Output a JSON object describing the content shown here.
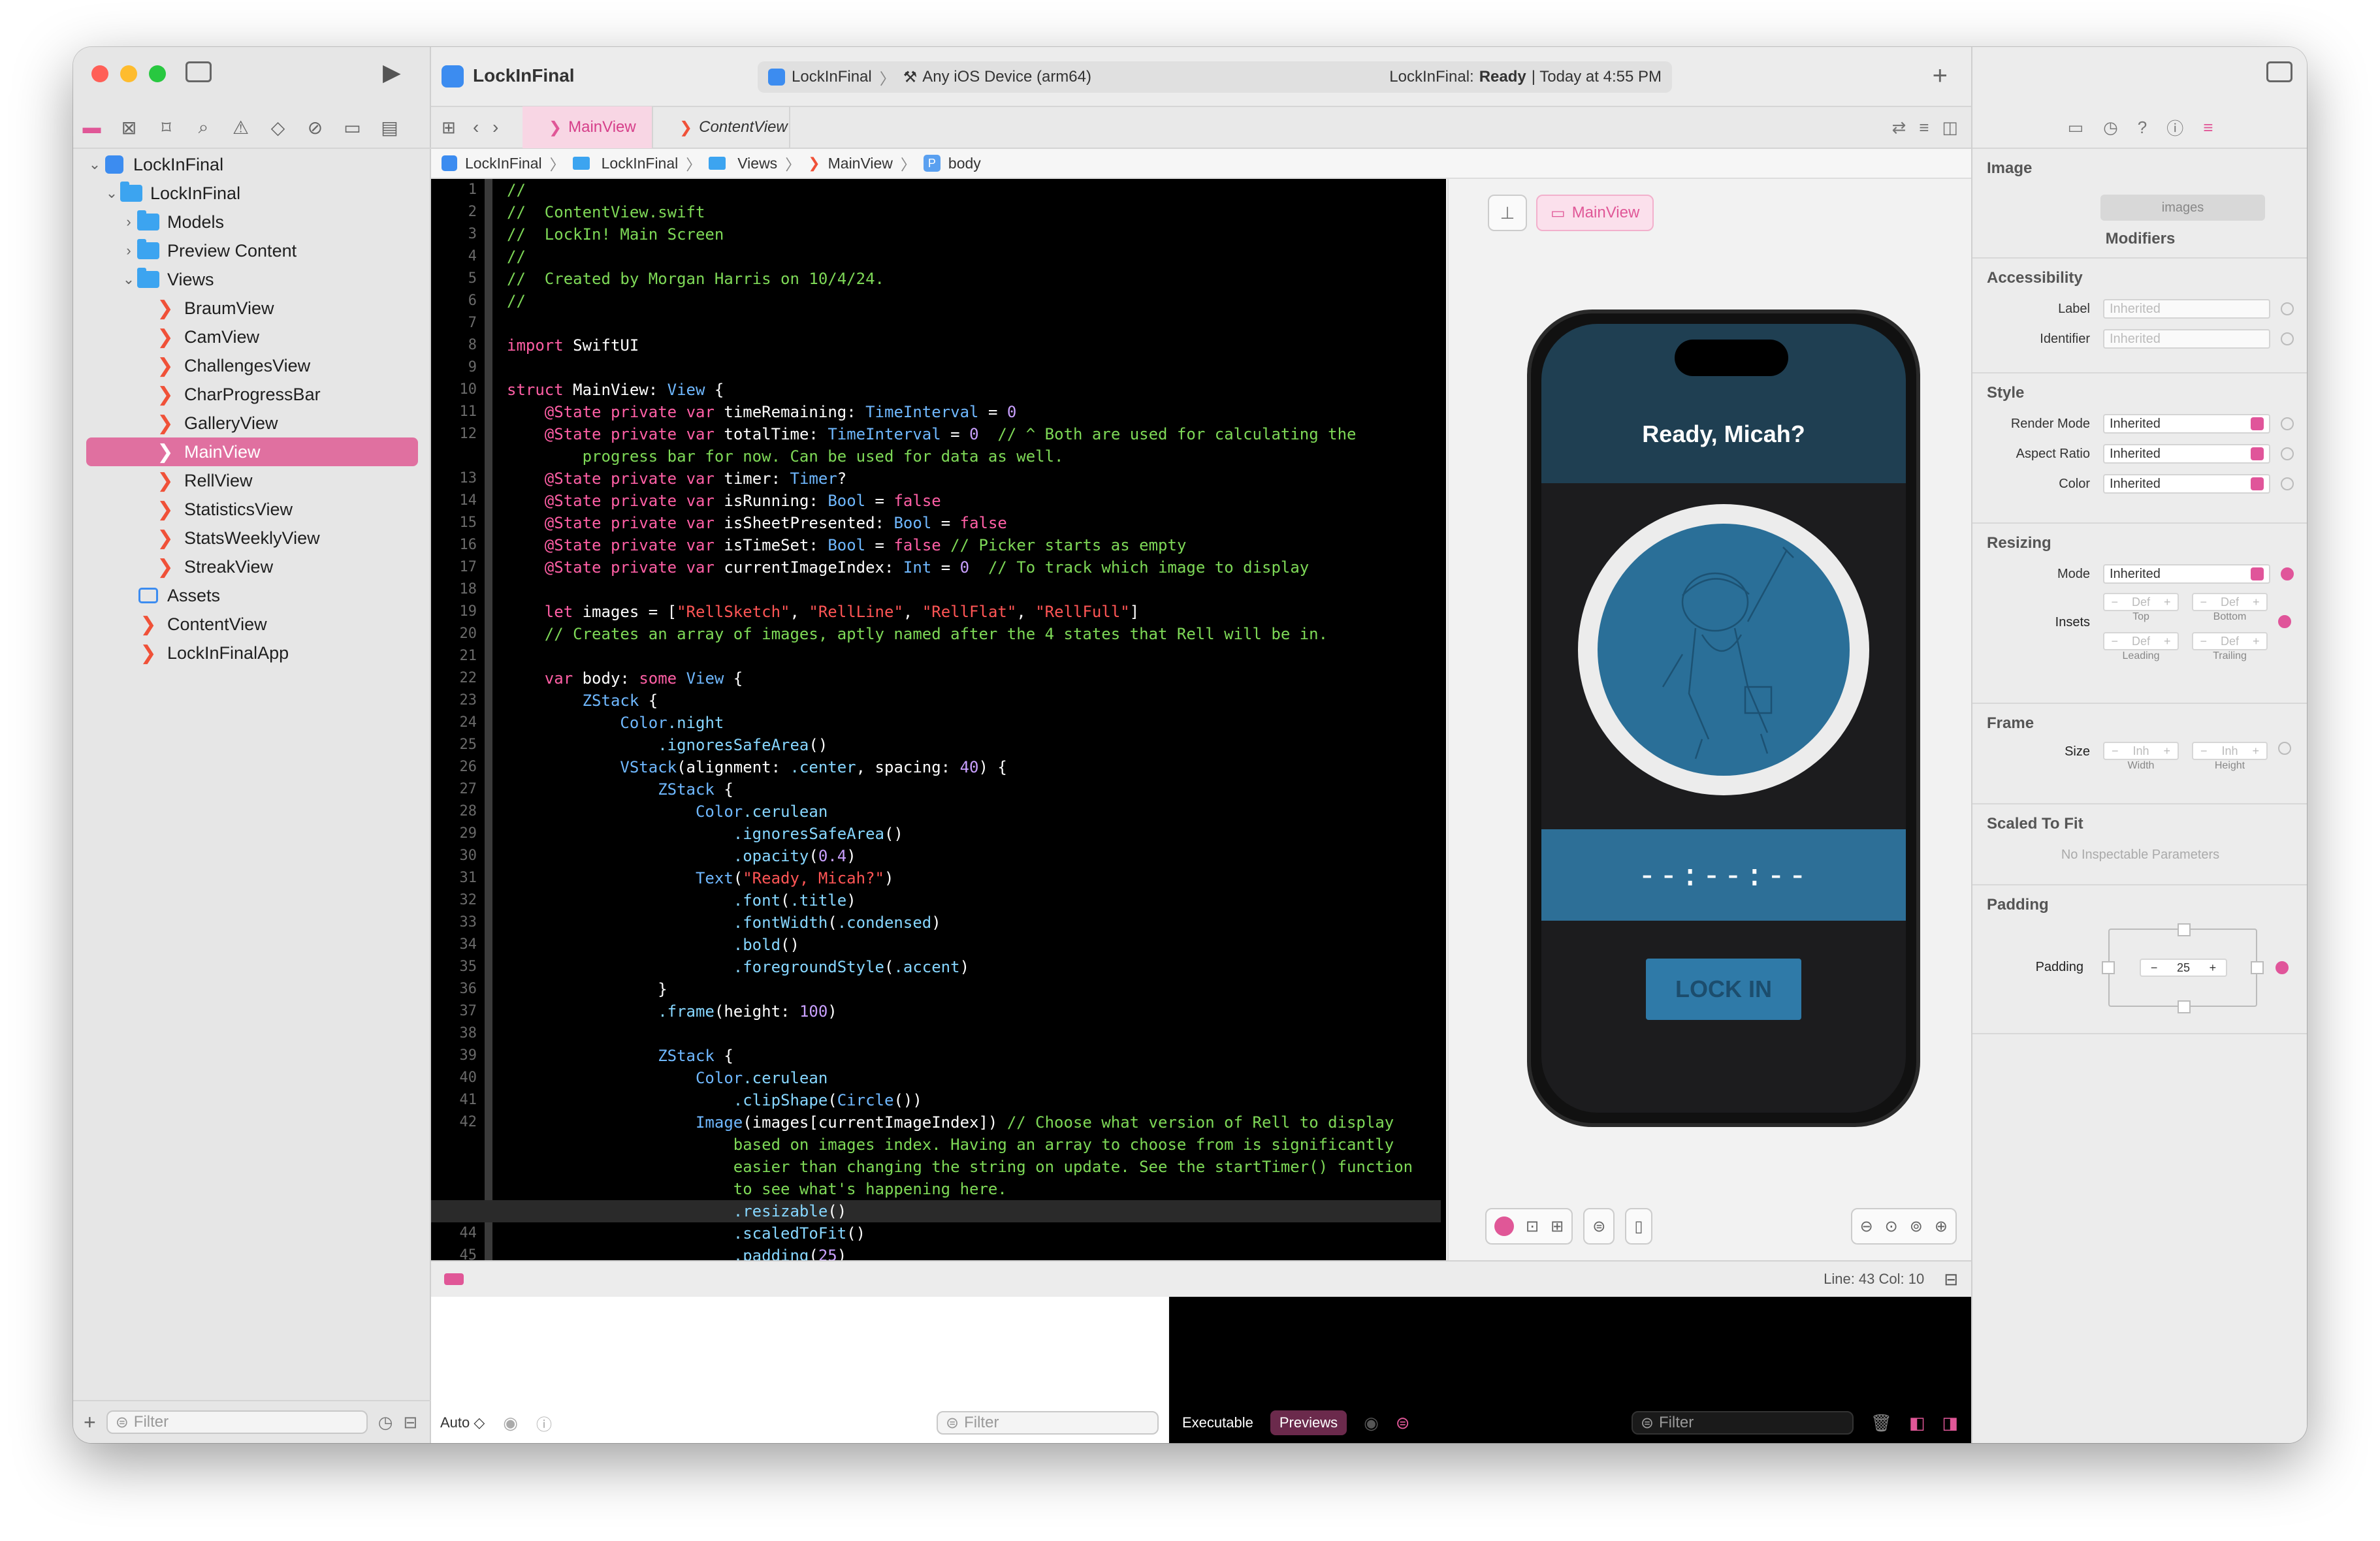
{
  "window": {
    "accent": "#e070a0"
  },
  "toolbar": {
    "project": "LockInFinal",
    "scheme": "LockInFinal",
    "destination": "Any iOS Device (arm64)",
    "status_prefix": "LockInFinal:",
    "status_state": "Ready",
    "status_time": "| Today at 4:55 PM"
  },
  "sidebar": {
    "root": "LockInFinal",
    "items": [
      {
        "label": "LockInFinal",
        "type": "folder",
        "level": 1,
        "open": true
      },
      {
        "label": "Models",
        "type": "folder",
        "level": 2,
        "open": false
      },
      {
        "label": "Preview Content",
        "type": "folder",
        "level": 2,
        "open": false
      },
      {
        "label": "Views",
        "type": "folder",
        "level": 2,
        "open": true
      },
      {
        "label": "BraumView",
        "type": "swift",
        "level": 3
      },
      {
        "label": "CamView",
        "type": "swift",
        "level": 3
      },
      {
        "label": "ChallengesView",
        "type": "swift",
        "level": 3
      },
      {
        "label": "CharProgressBar",
        "type": "swift",
        "level": 3
      },
      {
        "label": "GalleryView",
        "type": "swift",
        "level": 3
      },
      {
        "label": "MainView",
        "type": "swift",
        "level": 3,
        "selected": true
      },
      {
        "label": "RellView",
        "type": "swift",
        "level": 3
      },
      {
        "label": "StatisticsView",
        "type": "swift",
        "level": 3
      },
      {
        "label": "StatsWeeklyView",
        "type": "swift",
        "level": 3
      },
      {
        "label": "StreakView",
        "type": "swift",
        "level": 3
      },
      {
        "label": "Assets",
        "type": "assets",
        "level": 2
      },
      {
        "label": "ContentView",
        "type": "swift",
        "level": 2
      },
      {
        "label": "LockInFinalApp",
        "type": "swift",
        "level": 2
      }
    ],
    "filter_placeholder": "Filter"
  },
  "tabs": [
    {
      "label": "MainView",
      "active": true
    },
    {
      "label": "ContentView",
      "active": false
    }
  ],
  "breadcrumb": [
    "LockInFinal",
    "LockInFinal",
    "Views",
    "MainView",
    "body"
  ],
  "code": {
    "current_line": 43,
    "lines": [
      {
        "n": "1",
        "t": "//"
      },
      {
        "n": "2",
        "t": "//  ContentView.swift"
      },
      {
        "n": "3",
        "t": "//  LockIn! Main Screen"
      },
      {
        "n": "4",
        "t": "//"
      },
      {
        "n": "5",
        "t": "//  Created by Morgan Harris on 10/4/24."
      },
      {
        "n": "6",
        "t": "//"
      },
      {
        "n": "7",
        "t": ""
      },
      {
        "n": "8",
        "t": "import SwiftUI"
      },
      {
        "n": "9",
        "t": ""
      },
      {
        "n": "10",
        "t": "struct MainView: View {"
      },
      {
        "n": "11",
        "t": "    @State private var timeRemaining: TimeInterval = 0"
      },
      {
        "n": "12",
        "t": "    @State private var totalTime: TimeInterval = 0  // ^ Both are used for calculating the"
      },
      {
        "n": "",
        "t": "        progress bar for now. Can be used for data as well."
      },
      {
        "n": "13",
        "t": "    @State private var timer: Timer?"
      },
      {
        "n": "14",
        "t": "    @State private var isRunning: Bool = false"
      },
      {
        "n": "15",
        "t": "    @State private var isSheetPresented: Bool = false"
      },
      {
        "n": "16",
        "t": "    @State private var isTimeSet: Bool = false // Picker starts as empty"
      },
      {
        "n": "17",
        "t": "    @State private var currentImageIndex: Int = 0  // To track which image to display"
      },
      {
        "n": "18",
        "t": ""
      },
      {
        "n": "19",
        "t": "    let images = [\"RellSketch\", \"RellLine\", \"RellFlat\", \"RellFull\"]"
      },
      {
        "n": "20",
        "t": "    // Creates an array of images, aptly named after the 4 states that Rell will be in."
      },
      {
        "n": "21",
        "t": ""
      },
      {
        "n": "22",
        "t": "    var body: some View {"
      },
      {
        "n": "23",
        "t": "        ZStack {"
      },
      {
        "n": "24",
        "t": "            Color.night"
      },
      {
        "n": "25",
        "t": "                .ignoresSafeArea()"
      },
      {
        "n": "26",
        "t": "            VStack(alignment: .center, spacing: 40) {"
      },
      {
        "n": "27",
        "t": "                ZStack {"
      },
      {
        "n": "28",
        "t": "                    Color.cerulean"
      },
      {
        "n": "29",
        "t": "                        .ignoresSafeArea()"
      },
      {
        "n": "30",
        "t": "                        .opacity(0.4)"
      },
      {
        "n": "31",
        "t": "                    Text(\"Ready, Micah?\")"
      },
      {
        "n": "32",
        "t": "                        .font(.title)"
      },
      {
        "n": "33",
        "t": "                        .fontWidth(.condensed)"
      },
      {
        "n": "34",
        "t": "                        .bold()"
      },
      {
        "n": "35",
        "t": "                        .foregroundStyle(.accent)"
      },
      {
        "n": "36",
        "t": "                }"
      },
      {
        "n": "37",
        "t": "                .frame(height: 100)"
      },
      {
        "n": "38",
        "t": ""
      },
      {
        "n": "39",
        "t": "                ZStack {"
      },
      {
        "n": "40",
        "t": "                    Color.cerulean"
      },
      {
        "n": "41",
        "t": "                        .clipShape(Circle())"
      },
      {
        "n": "42",
        "t": "                    Image(images[currentImageIndex]) // Choose what version of Rell to display"
      },
      {
        "n": "",
        "t": "                        based on images index. Having an array to choose from is significantly"
      },
      {
        "n": "",
        "t": "                        easier than changing the string on update. See the startTimer() function"
      },
      {
        "n": "",
        "t": "                        to see what's happening here."
      },
      {
        "n": "43",
        "t": "                        .resizable()"
      },
      {
        "n": "44",
        "t": "                        .scaledToFit()"
      },
      {
        "n": "45",
        "t": "                        .padding(25)"
      }
    ]
  },
  "preview": {
    "tag": "MainView",
    "app_title": "Ready, Micah?",
    "timer_text": "--:--:--",
    "button_label": "LOCK IN"
  },
  "status_bar": {
    "line_col": "Line: 43  Col: 10"
  },
  "debug": {
    "auto_label": "Auto ◇",
    "filter_placeholder": "Filter",
    "tab_executable": "Executable",
    "tab_previews": "Previews"
  },
  "inspector": {
    "image_label": "Image",
    "image_value": "images",
    "modifiers_title": "Modifiers",
    "accessibility_title": "Accessibility",
    "label_label": "Label",
    "label_placeholder": "Inherited",
    "identifier_label": "Identifier",
    "identifier_placeholder": "Inherited",
    "style_title": "Style",
    "render_mode_label": "Render Mode",
    "render_mode_value": "Inherited",
    "aspect_ratio_label": "Aspect Ratio",
    "aspect_ratio_value": "Inherited",
    "color_label": "Color",
    "color_value": "Inherited",
    "resizing_title": "Resizing",
    "mode_label": "Mode",
    "mode_value": "Inherited",
    "insets_label": "Insets",
    "inset_top": "Def",
    "inset_bottom": "Def",
    "inset_leading": "Def",
    "inset_trailing": "Def",
    "top_label": "Top",
    "bottom_label": "Bottom",
    "leading_label": "Leading",
    "trailing_label": "Trailing",
    "frame_title": "Frame",
    "size_label": "Size",
    "width_value": "Inh",
    "height_value": "Inh",
    "width_label": "Width",
    "height_label": "Height",
    "scaled_title": "Scaled To Fit",
    "scaled_empty": "No Inspectable Parameters",
    "padding_title": "Padding",
    "padding_label": "Padding",
    "padding_value": "25"
  }
}
